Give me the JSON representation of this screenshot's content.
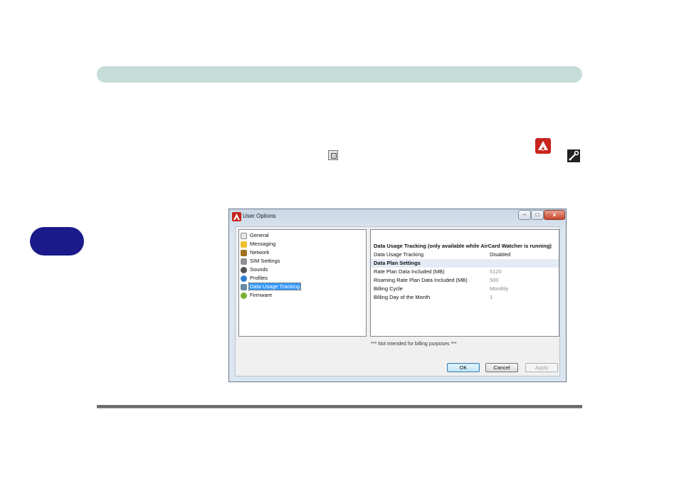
{
  "dialog": {
    "title": "User Options",
    "window_buttons": {
      "minimize": "–",
      "maximize": "□",
      "close": "x"
    },
    "tree": [
      {
        "label": "General",
        "icon": "general-icon",
        "color": "#e8e8e8"
      },
      {
        "label": "Messaging",
        "icon": "messaging-icon",
        "color": "#f0c030"
      },
      {
        "label": "Network",
        "icon": "network-icon",
        "color": "#a07020"
      },
      {
        "label": "SIM Settings",
        "icon": "sim-settings-icon",
        "color": "#909090"
      },
      {
        "label": "Sounds",
        "icon": "sounds-icon",
        "color": "#505050"
      },
      {
        "label": "Profiles",
        "icon": "profiles-icon",
        "color": "#2f7fd0"
      },
      {
        "label": "Data Usage Tracking",
        "icon": "data-usage-icon",
        "color": "#6a8aa0",
        "selected": true
      },
      {
        "label": "Firmware",
        "icon": "firmware-icon",
        "color": "#7ab030"
      }
    ],
    "settings": {
      "header": "Data Usage Tracking (only available while AirCard Watcher is running)",
      "tracking": {
        "label": "Data Usage Tracking",
        "value": "Disabled"
      },
      "section": "Data Plan Settings",
      "rows": [
        {
          "label": "Rate Plan Data Included (MB)",
          "value": "5120"
        },
        {
          "label": "Roaming Rate Plan Data Included (MB)",
          "value": "500"
        },
        {
          "label": "Billing Cycle",
          "value": "Monthly"
        },
        {
          "label": "Billing Day of the Month",
          "value": "1"
        }
      ]
    },
    "note": "*** Not intended for billing purposes ***",
    "buttons": {
      "ok": "OK",
      "cancel": "Cancel",
      "apply": "Apply"
    }
  },
  "colors": {
    "header_bar": "#c5dcd8",
    "side_tab": "#1a1a8a",
    "selection": "#3399ff"
  }
}
